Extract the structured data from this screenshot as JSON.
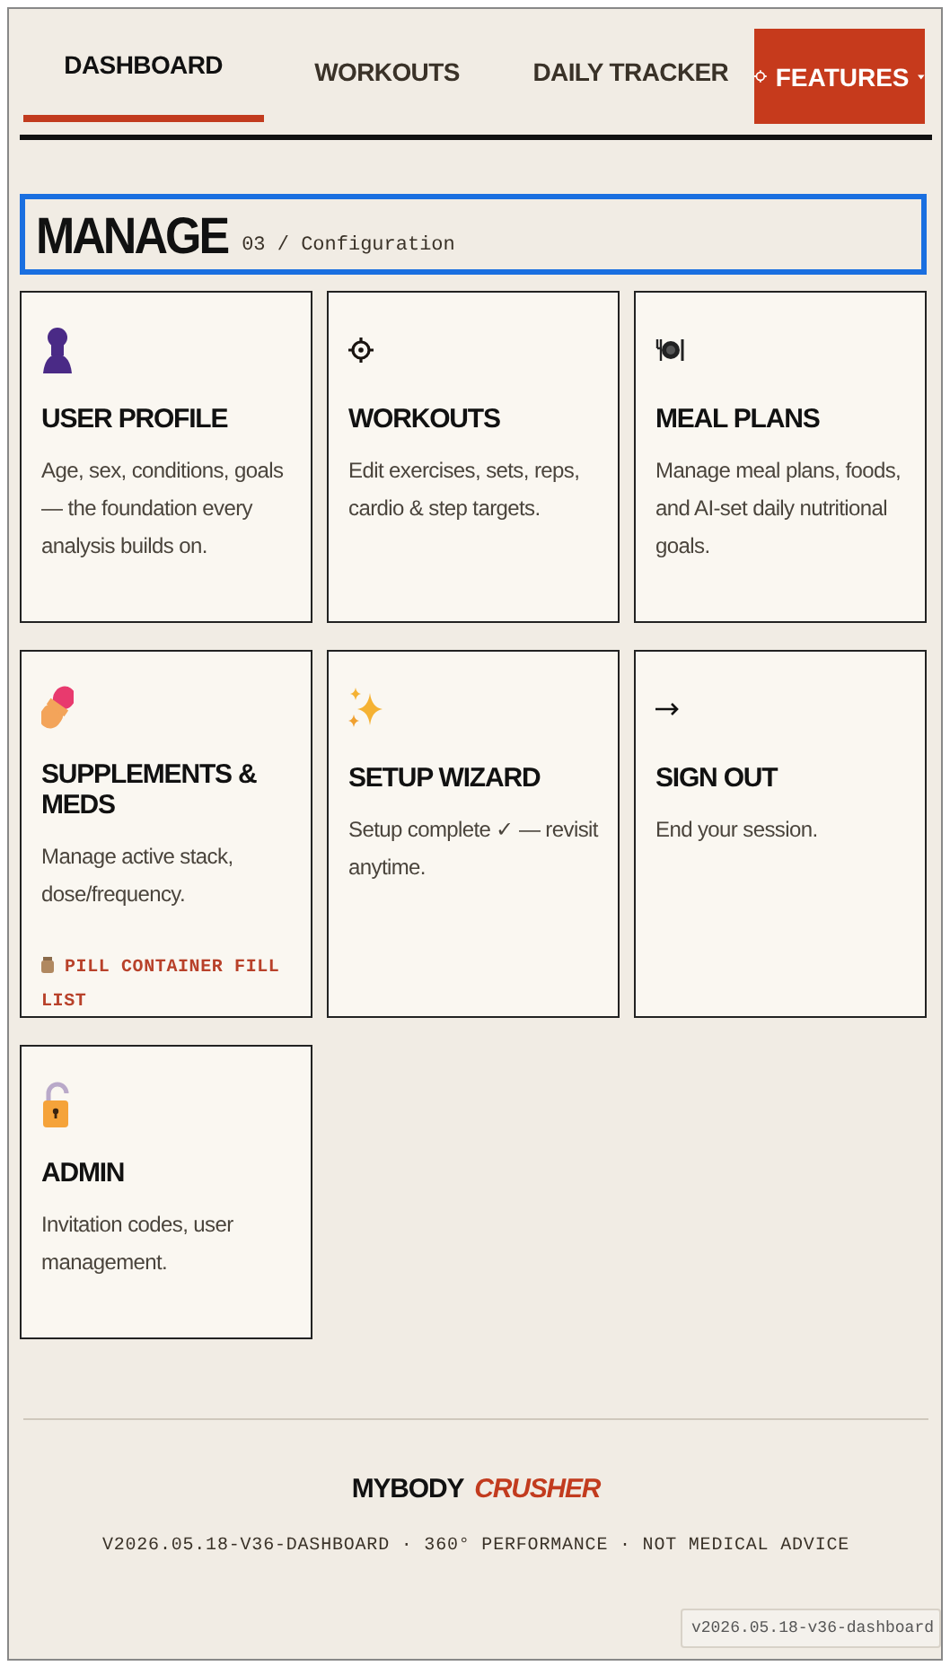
{
  "nav": {
    "tabs": [
      {
        "label": "DASHBOARD",
        "selected": true
      },
      {
        "label": "WORKOUTS",
        "selected": false
      },
      {
        "label": "DAILY TRACKER",
        "selected": false
      }
    ],
    "menu_button": {
      "label": "FEATURES"
    }
  },
  "section": {
    "title": "MANAGE",
    "subtitle": "03 / Configuration",
    "highlighted": true
  },
  "cards": [
    {
      "title": "USER PROFILE",
      "description": "Age, sex, conditions, goals — the foundation every analysis builds on."
    },
    {
      "title": "WORKOUTS",
      "description": "Edit exercises, sets, reps, cardio & step targets."
    },
    {
      "title": "MEAL PLANS",
      "description": "Manage meal plans, foods, and AI-set daily nutritional goals."
    },
    {
      "title": "SUPPLEMENTS & MEDS",
      "description": "Manage active stack, dose/frequency.",
      "link": "PILL CONTAINER FILL LIST"
    },
    {
      "title": "SETUP WIZARD",
      "description": "Setup complete ✓ — revisit anytime."
    },
    {
      "title": "SIGN OUT",
      "description": "End your session."
    },
    {
      "title": "ADMIN",
      "description": "Invitation codes, user management."
    }
  ],
  "footer": {
    "brand": "MYBODY",
    "brand_accent": "CRUSHER",
    "tagline": "V2026.05.18-V36-DASHBOARD · 360° PERFORMANCE · NOT MEDICAL ADVICE"
  },
  "version_badge": "v2026.05.18-v36-dashboard"
}
